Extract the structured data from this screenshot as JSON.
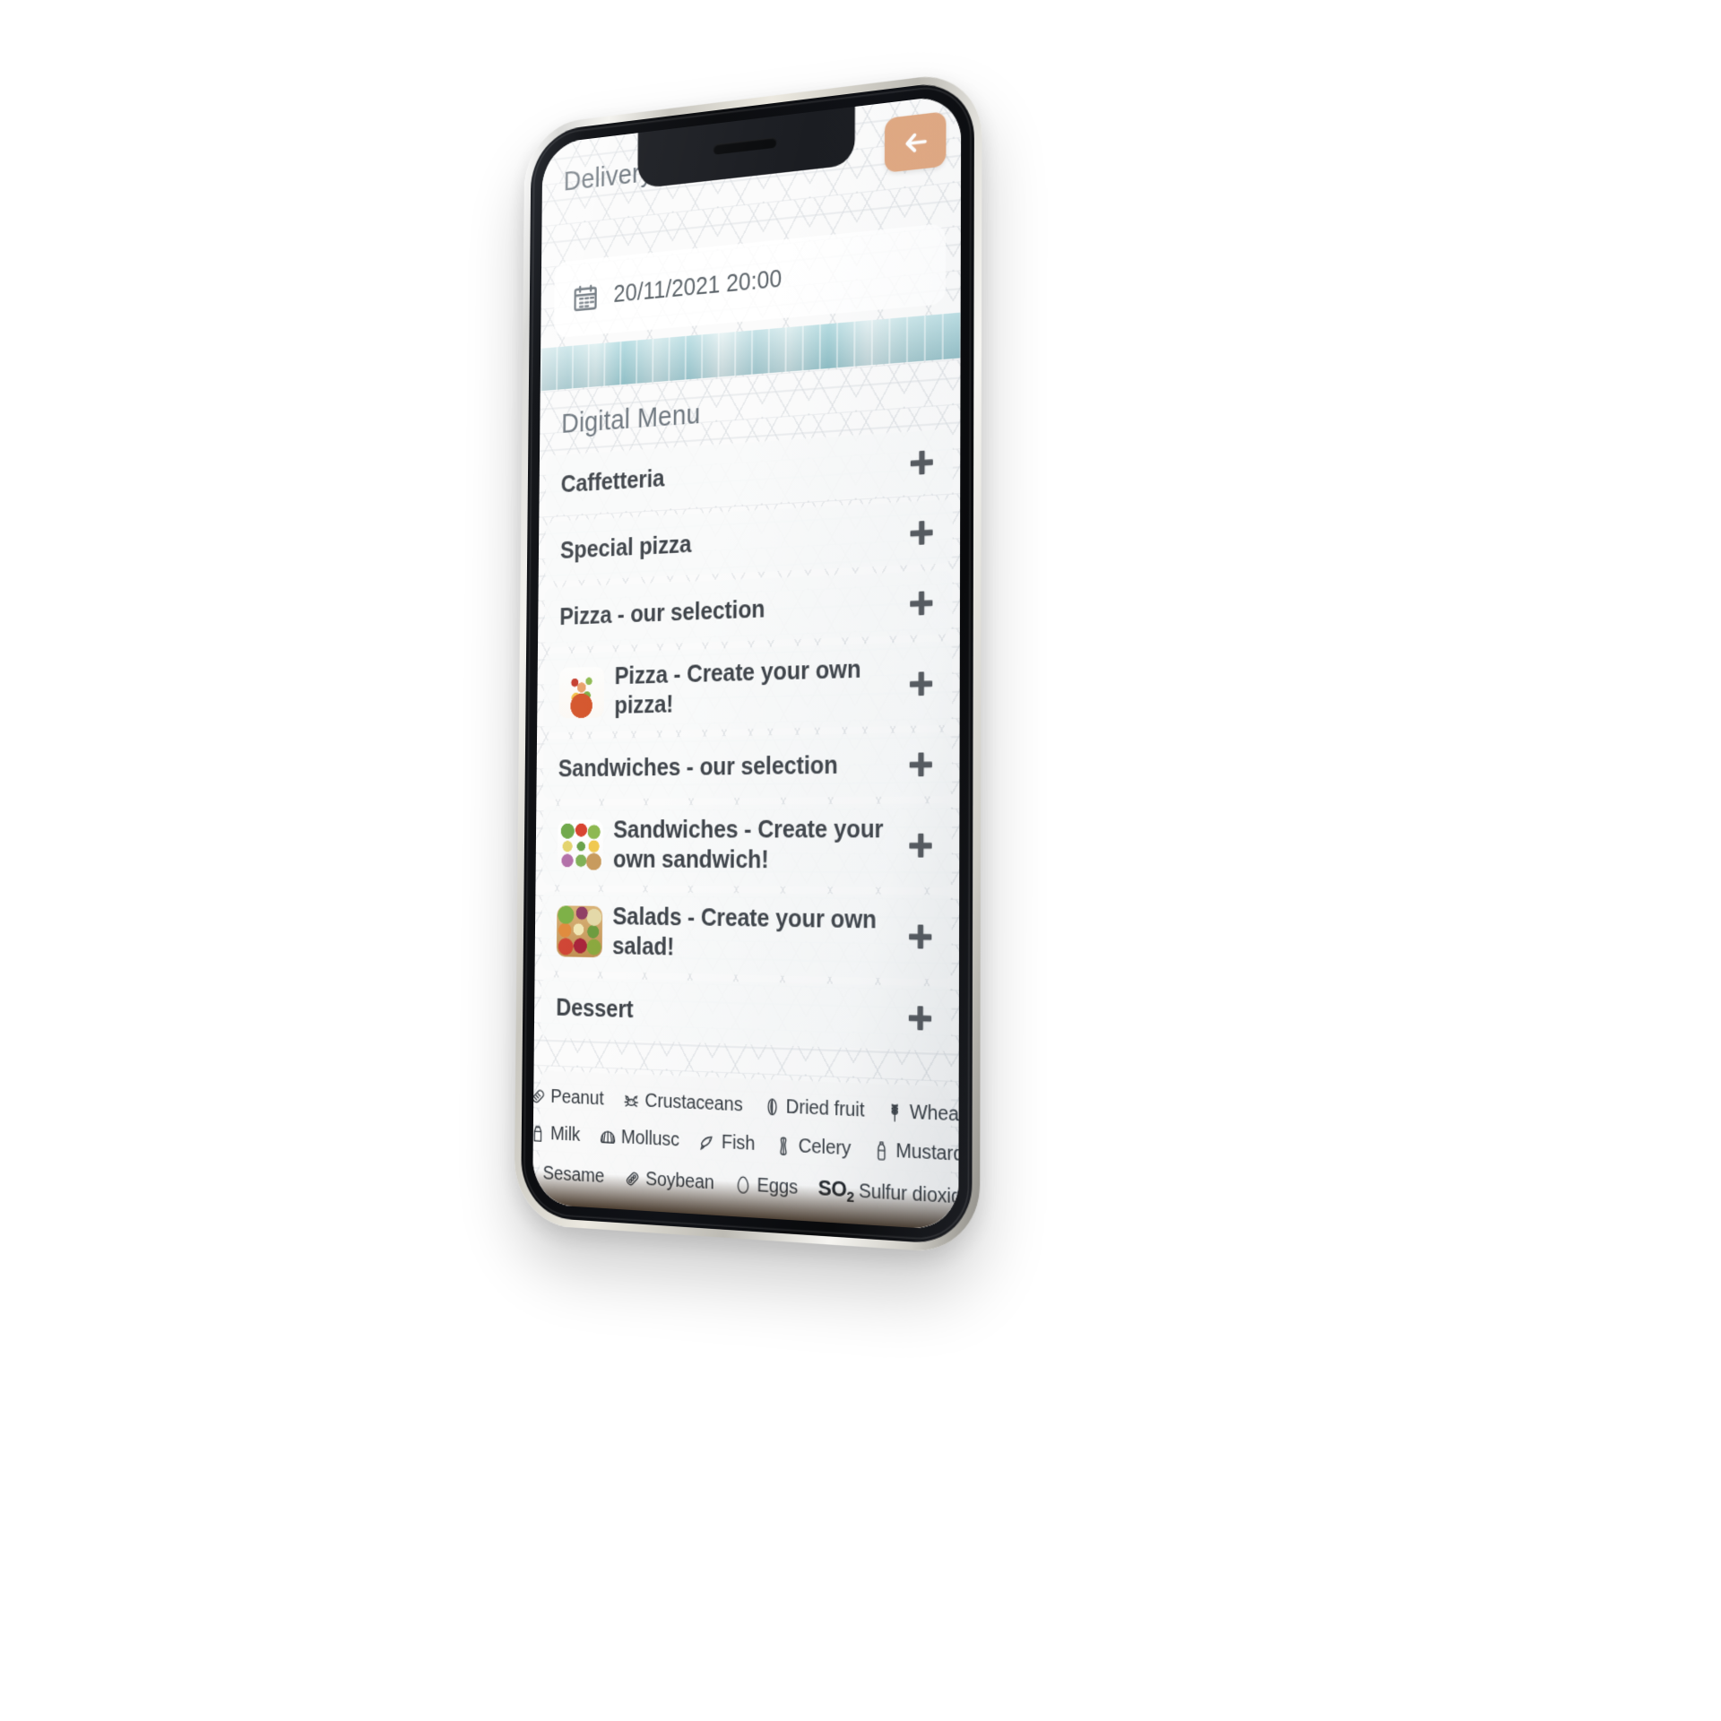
{
  "app": {
    "page_title": "Delivery",
    "back_button_icon": "arrow-left-icon",
    "accent_color": "#e0a882"
  },
  "delivery": {
    "calendar_icon": "calendar-icon",
    "datetime": "20/11/2021 20:00"
  },
  "menu": {
    "section_title": "Digital Menu",
    "expand_icon": "plus-icon",
    "items": [
      {
        "label": "Caffetteria",
        "thumb": null
      },
      {
        "label": "Special pizza",
        "thumb": null
      },
      {
        "label": "Pizza - our selection",
        "thumb": null
      },
      {
        "label": "Pizza - Create your own pizza!",
        "thumb": "pizza-thumbnail"
      },
      {
        "label": "Sandwiches - our selection",
        "thumb": null
      },
      {
        "label": "Sandwiches - Create your own sandwich!",
        "thumb": "sandwich-thumbnail"
      },
      {
        "label": "Salads - Create your own salad!",
        "thumb": "salad-thumbnail"
      },
      {
        "label": "Dessert",
        "thumb": null
      }
    ]
  },
  "allergens": {
    "rows": [
      [
        {
          "label": "Peanut",
          "icon": "peanut-icon"
        },
        {
          "label": "Crustaceans",
          "icon": "crab-icon"
        },
        {
          "label": "Dried fruit",
          "icon": "nut-icon"
        },
        {
          "label": "Wheat",
          "icon": "wheat-icon"
        }
      ],
      [
        {
          "label": "Milk",
          "icon": "milk-carton-icon"
        },
        {
          "label": "Mollusc",
          "icon": "shell-icon"
        },
        {
          "label": "Fish",
          "icon": "fish-icon"
        },
        {
          "label": "Celery",
          "icon": "celery-icon"
        },
        {
          "label": "Mustard",
          "icon": "mustard-bottle-icon"
        }
      ],
      [
        {
          "label": "Sesame",
          "icon": "sesame-seeds-icon"
        },
        {
          "label": "Soybean",
          "icon": "soybean-pod-icon"
        },
        {
          "label": "Eggs",
          "icon": "egg-icon"
        },
        {
          "label": "Sulfur dioxide",
          "icon": "so2-text-icon"
        }
      ]
    ]
  }
}
